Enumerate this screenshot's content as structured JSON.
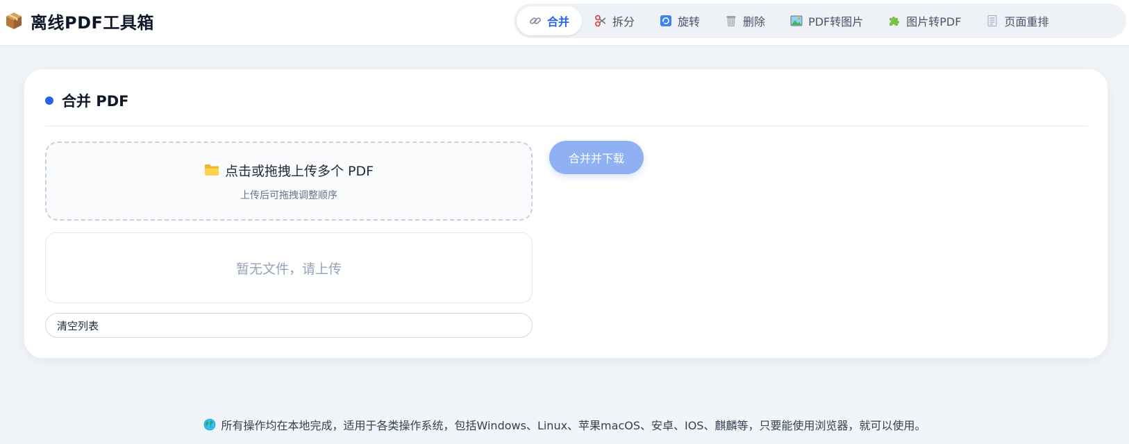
{
  "brand": {
    "title": "离线PDF工具箱",
    "icon": "package-icon"
  },
  "nav": {
    "items": [
      {
        "label": "合并",
        "icon": "link-icon",
        "active": true
      },
      {
        "label": "拆分",
        "icon": "scissors-icon",
        "active": false
      },
      {
        "label": "旋转",
        "icon": "rotate-icon",
        "active": false
      },
      {
        "label": "删除",
        "icon": "trash-icon",
        "active": false
      },
      {
        "label": "PDF转图片",
        "icon": "image-icon",
        "active": false
      },
      {
        "label": "图片转PDF",
        "icon": "puzzle-icon",
        "active": false
      },
      {
        "label": "页面重排",
        "icon": "document-icon",
        "active": false
      }
    ]
  },
  "card": {
    "title": "合并 PDF",
    "upload": {
      "main_label": "点击或拖拽上传多个 PDF",
      "sub_label": "上传后可拖拽调整顺序"
    },
    "file_list": {
      "empty_text": "暂无文件，请上传"
    },
    "clear_button": "清空列表",
    "merge_button": "合并并下载"
  },
  "footer": {
    "text": "所有操作均在本地完成，适用于各类操作系统，包括Windows、Linux、苹果macOS、安卓、IOS、麒麟等，只要能使用浏览器，就可以使用。"
  },
  "colors": {
    "accent": "#2563eb",
    "merge_button_bg": "#8fb0f2",
    "page_bg": "#f1f4f9"
  }
}
